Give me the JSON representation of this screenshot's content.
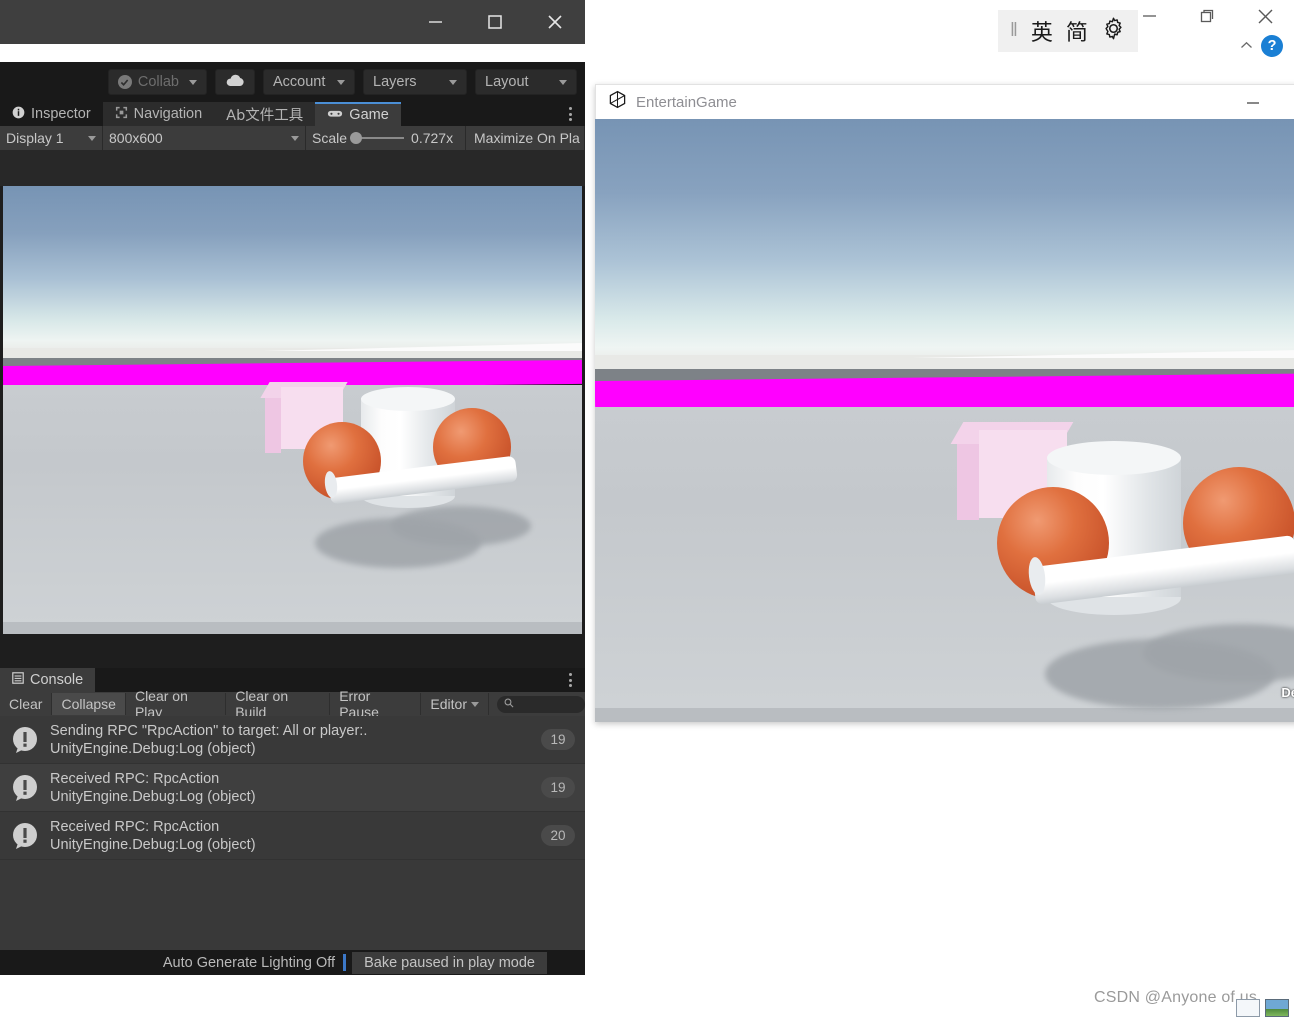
{
  "editor_window": {
    "title_controls": {
      "minimize": "minimize-icon",
      "maximize": "maximize-icon",
      "close": "close-icon"
    },
    "toolbar": {
      "collab_label": "Collab",
      "collab_icon": "check-circle-icon",
      "cloud_icon": "cloud-icon",
      "account_label": "Account",
      "layers_label": "Layers",
      "layout_label": "Layout"
    },
    "tabs": [
      {
        "label": "Inspector",
        "icon": "info-icon",
        "active": false
      },
      {
        "label": "Navigation",
        "icon": "navigation-icon",
        "active": false
      },
      {
        "label": "Ab文件工具",
        "icon": "none",
        "active": false
      },
      {
        "label": "Game",
        "icon": "gamepad-icon",
        "active": true
      }
    ],
    "game_toolbar": {
      "display_label": "Display 1",
      "resolution_label": "800x600",
      "scale_label": "Scale",
      "scale_value": "0.727x",
      "maximize_label": "Maximize On Pla"
    },
    "console": {
      "tab_label": "Console",
      "tab_icon": "console-icon",
      "buttons": [
        {
          "label": "Clear",
          "pressed": false
        },
        {
          "label": "Collapse",
          "pressed": true
        },
        {
          "label": "Clear on Play",
          "pressed": false
        },
        {
          "label": "Clear on Build",
          "pressed": false
        },
        {
          "label": "Error Pause",
          "pressed": false
        },
        {
          "label": "Editor",
          "pressed": false,
          "dropdown": true
        }
      ],
      "search_placeholder": "",
      "search_icon": "search-icon",
      "logs": [
        {
          "icon": "warning-icon",
          "message": "Sending RPC \"RpcAction\" to target: All or player:.",
          "stack": "UnityEngine.Debug:Log (object)",
          "count": "19"
        },
        {
          "icon": "warning-icon",
          "message": "Received RPC: RpcAction",
          "stack": "UnityEngine.Debug:Log (object)",
          "count": "19"
        },
        {
          "icon": "warning-icon",
          "message": "Received RPC: RpcAction",
          "stack": "UnityEngine.Debug:Log (object)",
          "count": "20"
        }
      ]
    },
    "status_bar": {
      "lighting_label": "Auto Generate Lighting Off",
      "bake_label": "Bake paused in play mode"
    }
  },
  "game_window": {
    "title": "EntertainGame",
    "title_icon": "unity-logo-icon",
    "minimize_icon": "minimize-icon",
    "overlay_text": "De"
  },
  "os_chrome": {
    "ime": {
      "pipe": "‖",
      "mode_lang": "英",
      "mode_shape": "简",
      "settings_icon": "gear-icon"
    },
    "window_controls": {
      "minimize": "minimize-icon",
      "restore": "restore-icon",
      "close": "close-icon"
    },
    "chevron_icon": "chevron-up-icon",
    "help_label": "?"
  },
  "watermark": {
    "text": "CSDN @Anyone of us."
  },
  "scene": {
    "colors": {
      "sky_top": "#7794b4",
      "sky_horizon": "#eef4f2",
      "magenta_band": "#ff00ff",
      "ground": "#c8ccd0",
      "sphere": "#e0703f",
      "cylinder": "#ffffff",
      "box": "#f7deef"
    },
    "objects": [
      "cylinder-body",
      "cylinder-arm",
      "sphere-left",
      "sphere-right",
      "pink-box",
      "ground-plane",
      "magenta-wall"
    ]
  }
}
